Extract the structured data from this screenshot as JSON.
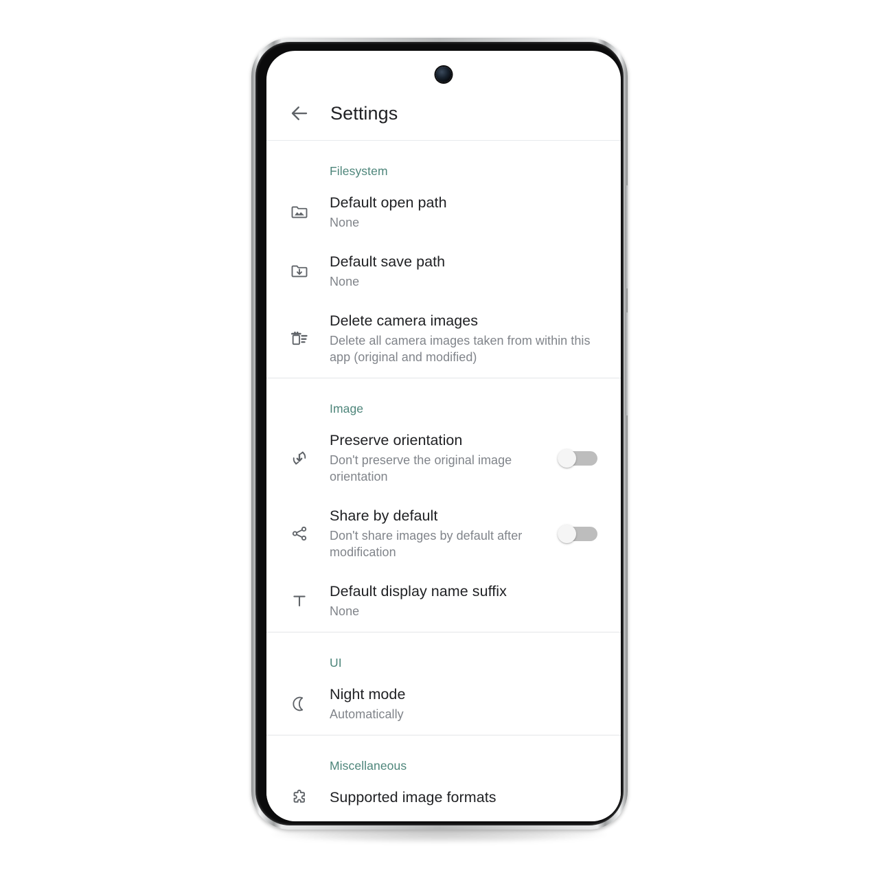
{
  "appbar": {
    "back_icon": "arrow-back-icon",
    "title": "Settings"
  },
  "theme": {
    "section_header_color": "#4d857a",
    "title_color": "#202124",
    "subtitle_color": "#80848a",
    "icon_color": "#5f6368",
    "divider_color": "#e3e5e7",
    "toggle_track_off": "#bdbdbd",
    "toggle_thumb_off": "#f5f5f5"
  },
  "sections": [
    {
      "title": "Filesystem",
      "rows": [
        {
          "icon": "folder-image-icon",
          "title": "Default open path",
          "subtitle": "None",
          "control": "none"
        },
        {
          "icon": "folder-download-icon",
          "title": "Default save path",
          "subtitle": "None",
          "control": "none"
        },
        {
          "icon": "delete-sweep-icon",
          "title": "Delete camera images",
          "subtitle": "Delete all camera images taken from within this app (original and modified)",
          "control": "none"
        }
      ]
    },
    {
      "title": "Image",
      "rows": [
        {
          "icon": "rotate-orientation-icon",
          "title": "Preserve orientation",
          "subtitle": "Don't preserve the original image orientation",
          "control": "switch",
          "switch_state": "off"
        },
        {
          "icon": "share-icon",
          "title": "Share by default",
          "subtitle": "Don't share images by default after modification",
          "control": "switch",
          "switch_state": "off"
        },
        {
          "icon": "text-format-icon",
          "title": "Default display name suffix",
          "subtitle": "None",
          "control": "none"
        }
      ]
    },
    {
      "title": "UI",
      "rows": [
        {
          "icon": "moon-icon",
          "title": "Night mode",
          "subtitle": "Automatically",
          "control": "none"
        }
      ]
    },
    {
      "title": "Miscellaneous",
      "rows": [
        {
          "icon": "puzzle-piece-icon",
          "title": "Supported image formats",
          "subtitle": "",
          "control": "none"
        }
      ]
    }
  ]
}
